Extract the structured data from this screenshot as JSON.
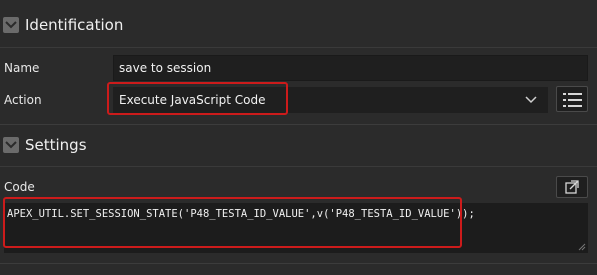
{
  "identification": {
    "title": "Identification",
    "name_label": "Name",
    "name_value": "save to session",
    "action_label": "Action",
    "action_value": "Execute JavaScript Code"
  },
  "settings": {
    "title": "Settings",
    "code_label": "Code",
    "code_value": "APEX_UTIL.SET_SESSION_STATE('P48_TESTA_ID_VALUE',v('P48_TESTA_ID_VALUE'));"
  },
  "colors": {
    "background": "#2b2b2b",
    "field": "#1f1f1f",
    "highlight": "#cc1b1b"
  }
}
